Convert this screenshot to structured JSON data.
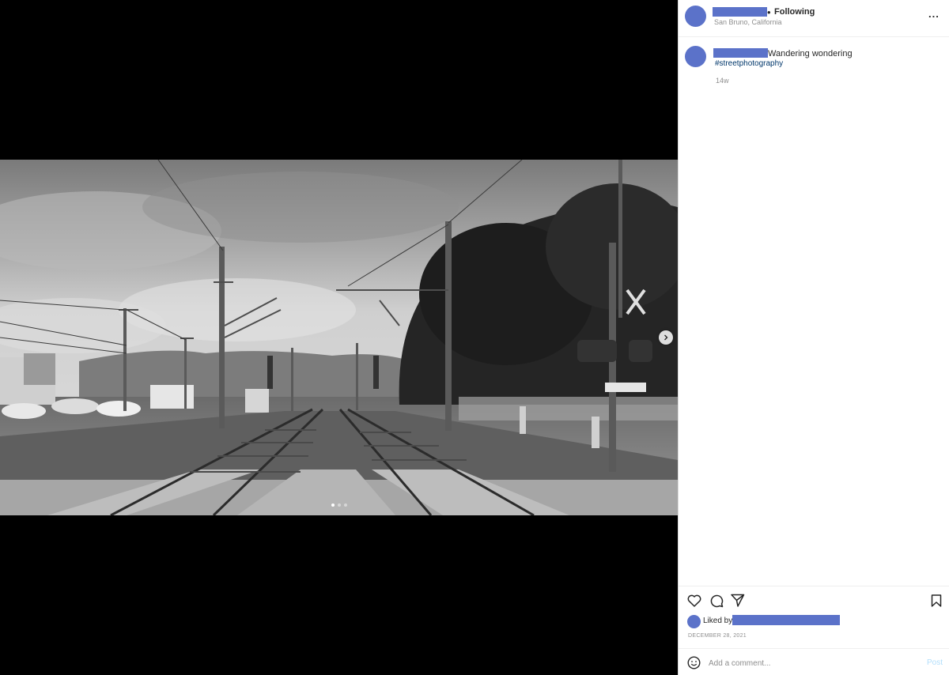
{
  "post": {
    "following_label": "Following",
    "header_dot": "•",
    "location": "San Bruno, California",
    "more_label": "...",
    "caption": "Wandering wondering",
    "hashtag": "#streetphotography",
    "age": "14w",
    "liked_by_label": "Liked by",
    "date": "DECEMBER 28, 2021"
  },
  "media": {
    "carousel_total": 3,
    "carousel_index": 1,
    "next_icon": "chevron-right-icon"
  },
  "actions": {
    "like_icon": "heart-icon",
    "comment_icon": "comment-icon",
    "share_icon": "share-icon",
    "save_icon": "bookmark-icon"
  },
  "comment": {
    "placeholder": "Add a comment...",
    "post_label": "Post",
    "emoji_icon": "emoji-icon"
  },
  "colors": {
    "redaction": "#5b72c9",
    "hashtag": "#00376b",
    "post_disabled": "#b2dffc"
  }
}
